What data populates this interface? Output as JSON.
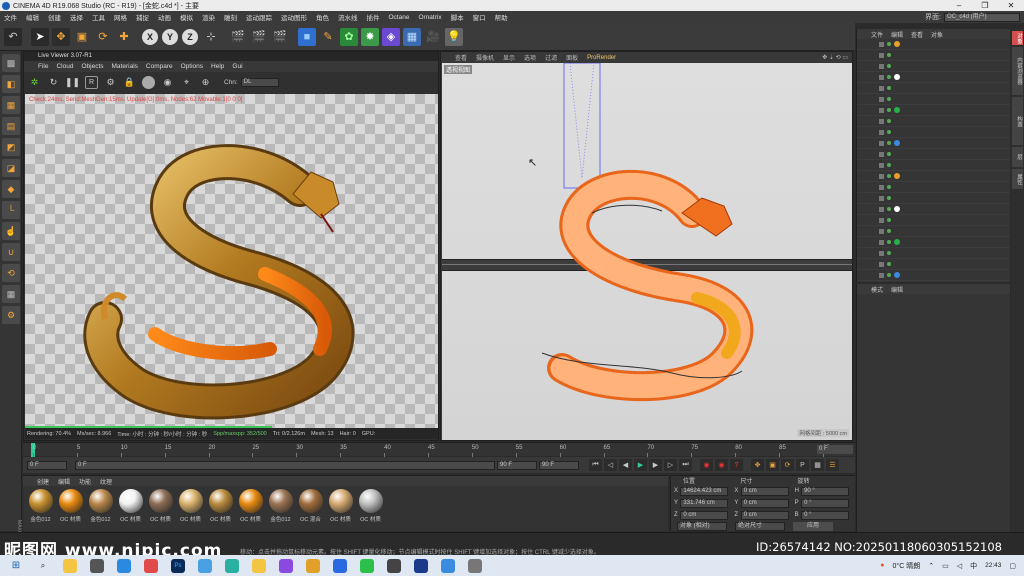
{
  "window": {
    "title": "CINEMA 4D R19.068 Studio (RC - R19) - [金蛇.c4d *] - 主要"
  },
  "menu": [
    "文件",
    "编辑",
    "创建",
    "选择",
    "工具",
    "网格",
    "捕捉",
    "动画",
    "模拟",
    "渲染",
    "雕刻",
    "运动跟踪",
    "运动图形",
    "角色",
    "流水线",
    "插件",
    "Octane",
    "Ornatrix",
    "脚本",
    "窗口",
    "帮助"
  ],
  "layout": {
    "label": "界面:",
    "value": "OC_c4d (用户)"
  },
  "toolbar": {
    "axes": [
      "X",
      "Y",
      "Z"
    ]
  },
  "live_viewer": {
    "title": "Live Viewer 3.07-R1",
    "menu": [
      "File",
      "Cloud",
      "Objects",
      "Materials",
      "Compare",
      "Options",
      "Help",
      "Gui"
    ],
    "channel_label": "Chn:",
    "channel_value": "DL",
    "overlay": "Check:24ms. Send:MeshGen:15ms. Update[G]:0ms. Nodes:62 Movable:1[0 0 0]",
    "progress": 0.704,
    "status": {
      "rendering": "Rendering: 70.4%",
      "ms": "Ms/sec: 8.966",
      "time": "Time: 小时 : 分钟 : 秒/小时 : 分钟 : 秒",
      "spp": "Spp/maxspp: 352/500",
      "tri": "Tri: 0/2.126m",
      "mesh": "Mesh: 13",
      "hair": "Hair: 0",
      "gpu": "GPU: "
    }
  },
  "viewport": {
    "menu": [
      "查看",
      "摄像机",
      "显示",
      "选项",
      "过滤",
      "面板"
    ],
    "renderer": "ProRender",
    "label": "透视视图",
    "scale": "网格间距 : 5000 cm"
  },
  "object_manager": {
    "menu": [
      "文件",
      "编辑",
      "查看",
      "对象"
    ],
    "rows": 22
  },
  "attribute_manager": {
    "menu": [
      "模式",
      "编辑"
    ]
  },
  "right_tabs": [
    "对象",
    "内容浏览器",
    "构造",
    "层",
    "属性"
  ],
  "timeline": {
    "ticks": [
      "0",
      "5",
      "10",
      "15",
      "20",
      "25",
      "30",
      "35",
      "40",
      "45",
      "50",
      "55",
      "60",
      "65",
      "70",
      "75",
      "80",
      "85",
      "90"
    ],
    "end_frame": "0 F"
  },
  "transport": {
    "current": "0 F",
    "start": "0 F",
    "end": "90 F",
    "end2": "90 F"
  },
  "materials": {
    "menu": [
      "创建",
      "编辑",
      "功能",
      "纹理"
    ],
    "items": [
      {
        "label": "金色012",
        "color": "#c8902f"
      },
      {
        "label": "OC 材质",
        "color": "#e88a10"
      },
      {
        "label": "金色012",
        "color": "#b9874a"
      },
      {
        "label": "OC 材质",
        "color": "#f2f2f2"
      },
      {
        "label": "OC 材质",
        "color": "#8c6d55"
      },
      {
        "label": "OC 材质",
        "color": "#d9b26a"
      },
      {
        "label": "OC 材质",
        "color": "#b98b3d"
      },
      {
        "label": "OC 材质",
        "color": "#e88a10"
      },
      {
        "label": "金色012",
        "color": "#9a7353"
      },
      {
        "label": "OC 混合",
        "color": "#a06d3c"
      },
      {
        "label": "OC 材质",
        "color": "#d6a970"
      },
      {
        "label": "OC 材质",
        "color": "#c0c0c0"
      }
    ]
  },
  "coordinates": {
    "headers": [
      "位置",
      "尺寸",
      "旋转"
    ],
    "rows": [
      {
        "axis": "X",
        "pos": "14624.423 cm",
        "size": "0 cm",
        "rot_axis": "H",
        "rot": "90 °"
      },
      {
        "axis": "Y",
        "pos": "331.746 cm",
        "size": "0 cm",
        "rot_axis": "P",
        "rot": "0 °"
      },
      {
        "axis": "Z",
        "pos": "0 cm",
        "size": "0 cm",
        "rot_axis": "B",
        "rot": "0 °"
      }
    ],
    "mode": "对象 (相对)",
    "size_mode": "绝对尺寸",
    "apply": "应用"
  },
  "hint": "移动：点击并拖动鼠标移动元素。按住 SHIFT 键量化移动；节点编辑模式时按住 SHIFT 键增加选择对象；按住 CTRL 键减少选择对象。",
  "watermark": {
    "left": "昵图网 www.nipic.com",
    "right": "ID:26574142 NO:20250118060305152108"
  },
  "taskbar": {
    "weather": "0°C 晴朗",
    "ime": "中",
    "time": "22:43"
  },
  "colors": {
    "accent": "#3bc45a",
    "snake": "#e8651c",
    "gold": "#c9972f"
  }
}
